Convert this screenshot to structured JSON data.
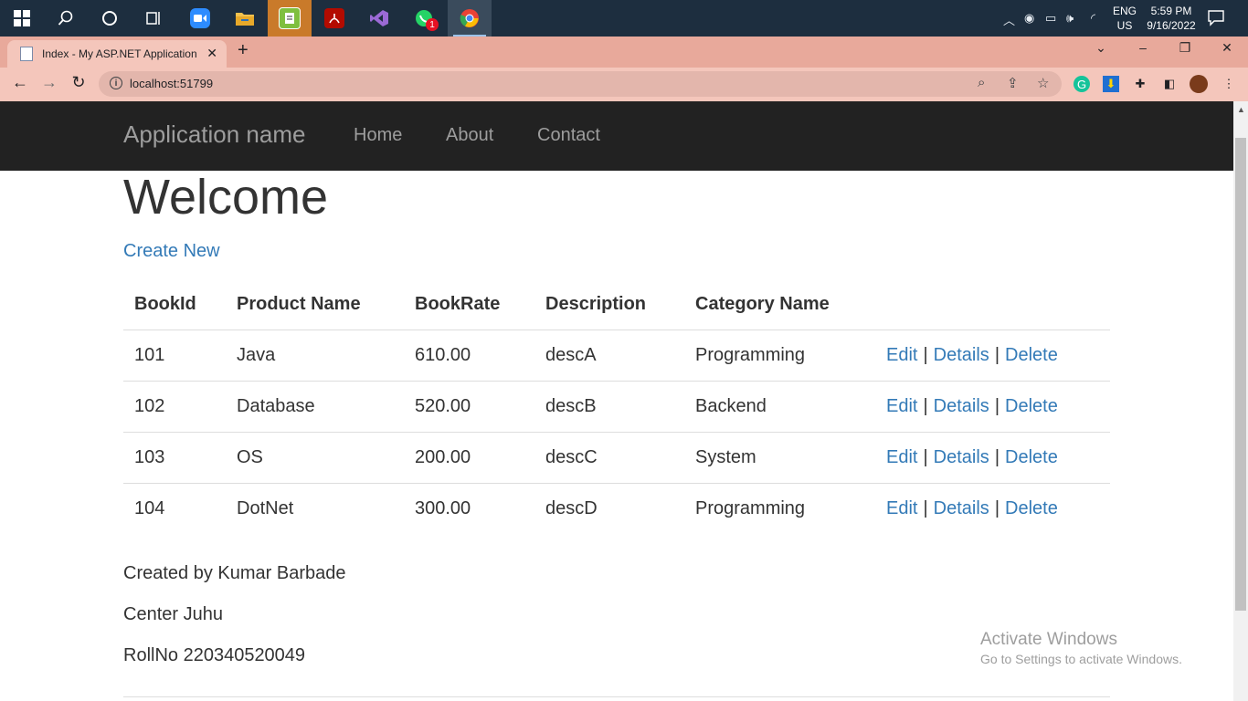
{
  "taskbar": {
    "apps": [
      {
        "name": "start",
        "glyph": "⊞"
      },
      {
        "name": "search",
        "glyph": "⌕"
      },
      {
        "name": "cortana",
        "glyph": "○"
      },
      {
        "name": "task-view",
        "glyph": "⧉"
      },
      {
        "name": "zoom",
        "glyph": "▶",
        "color": "#2d8cff"
      },
      {
        "name": "file-explorer",
        "glyph": "▬",
        "color": "#f2c14e"
      },
      {
        "name": "notepad",
        "glyph": "✎",
        "color": "#7fbf3f"
      },
      {
        "name": "acrobat",
        "glyph": "A",
        "color": "#d0021b"
      },
      {
        "name": "visual-studio",
        "glyph": "◆",
        "color": "#9b6ad6"
      },
      {
        "name": "whatsapp",
        "glyph": "✆",
        "color": "#25d366"
      },
      {
        "name": "chrome",
        "glyph": "●",
        "color": "#e94235"
      }
    ],
    "whatsapp_badge": "1",
    "tray": {
      "lang_top": "ENG",
      "lang_bottom": "US",
      "time": "5:59 PM",
      "date": "9/16/2022"
    }
  },
  "browser": {
    "tab_title": "Index - My ASP.NET Application",
    "url": "localhost:51799",
    "profile_color": "#7a3b1b"
  },
  "page": {
    "brand": "Application name",
    "nav": [
      "Home",
      "About",
      "Contact"
    ],
    "heading": "Welcome",
    "create_new": "Create New",
    "table": {
      "headers": [
        "BookId",
        "Product Name",
        "BookRate",
        "Description",
        "Category Name"
      ],
      "rows": [
        {
          "id": "101",
          "name": "Java",
          "rate": "610.00",
          "desc": "descA",
          "category": "Programming"
        },
        {
          "id": "102",
          "name": "Database",
          "rate": "520.00",
          "desc": "descB",
          "category": "Backend"
        },
        {
          "id": "103",
          "name": "OS",
          "rate": "200.00",
          "desc": "descC",
          "category": "System"
        },
        {
          "id": "104",
          "name": "DotNet",
          "rate": "300.00",
          "desc": "descD",
          "category": "Programming"
        }
      ],
      "actions": [
        "Edit",
        "Details",
        "Delete"
      ],
      "separator": "|"
    },
    "footer": [
      "Created by Kumar Barbade",
      "Center Juhu",
      "RollNo 220340520049"
    ]
  },
  "watermark": {
    "line1": "Activate Windows",
    "line2": "Go to Settings to activate Windows."
  },
  "colors": {
    "link": "#337ab7",
    "navbar_bg": "#222222",
    "tab_strip": "#e8a99b"
  }
}
